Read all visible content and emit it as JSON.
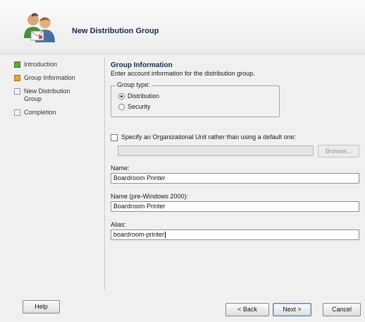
{
  "header": {
    "title": "New Distribution Group",
    "icon": "distribution-group-icon"
  },
  "nav": {
    "items": [
      {
        "label": "Introduction",
        "state": "done"
      },
      {
        "label": "Group Information",
        "state": "current"
      },
      {
        "label": "New Distribution Group",
        "state": "pending"
      },
      {
        "label": "Completion",
        "state": "pending"
      }
    ]
  },
  "content": {
    "title": "Group Information",
    "description": "Enter account information for the distribution group.",
    "group_type": {
      "legend": "Group type:",
      "options": [
        {
          "label": "Distribution",
          "checked": true
        },
        {
          "label": "Security",
          "checked": false
        }
      ]
    },
    "ou": {
      "checkbox_label": "Specify an Organizational Unit rather than using a default one:",
      "checked": false,
      "value": "",
      "browse_label": "Browse..."
    },
    "fields": {
      "name": {
        "label": "Name:",
        "value": "Boardroom Printer"
      },
      "pre_windows": {
        "label": "Name (pre-Windows 2000):",
        "value": "Boardroom Printer"
      },
      "alias": {
        "label": "Alias:",
        "value": "boardroom-printer"
      }
    }
  },
  "footer": {
    "help_label": "Help",
    "back_label": "< Back",
    "next_label": "Next >",
    "cancel_label": "Cancel"
  },
  "colors": {
    "step_done": "#62a542",
    "step_current": "#e3a82c",
    "title": "#1e2a48"
  }
}
